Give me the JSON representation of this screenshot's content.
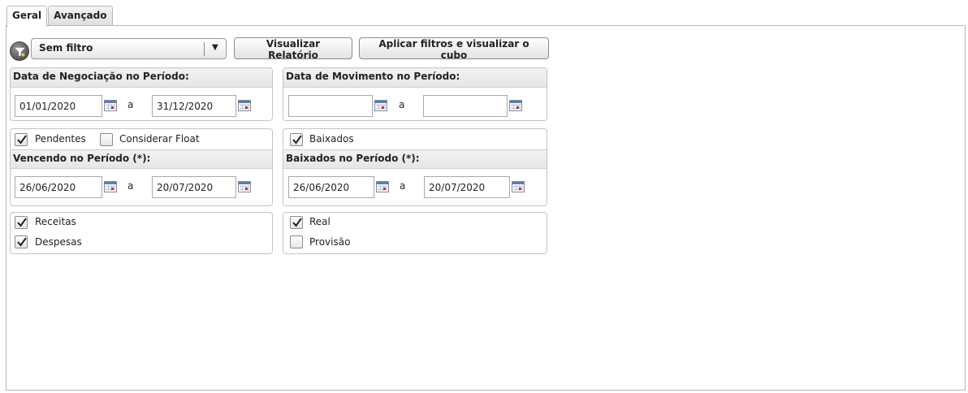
{
  "tabs": [
    {
      "label": "Geral",
      "active": true
    },
    {
      "label": "Avançado",
      "active": false
    }
  ],
  "toolbar": {
    "filter_select": "Sem filtro",
    "view_report_label": "Visualizar Relatório",
    "apply_filters_label": "Aplicar filtros e visualizar o cubo",
    "filter_icon": "filter-icon"
  },
  "negociacao": {
    "title": "Data de Negociação no Período:",
    "from": "01/01/2020",
    "to": "31/12/2020",
    "sep": "a"
  },
  "movimento": {
    "title": "Data de Movimento no Período:",
    "from": "",
    "to": "",
    "sep": "a"
  },
  "pendentes": {
    "pendentes_label": "Pendentes",
    "pendentes_checked": true,
    "float_label": "Considerar Float",
    "float_checked": false,
    "title": "Vencendo no Período (*):",
    "from": "26/06/2020",
    "to": "20/07/2020",
    "sep": "a"
  },
  "baixados": {
    "baixados_label": "Baixados",
    "baixados_checked": true,
    "title": "Baixados no Período (*):",
    "from": "26/06/2020",
    "to": "20/07/2020",
    "sep": "a"
  },
  "tipo": {
    "receitas_label": "Receitas",
    "receitas_checked": true,
    "despesas_label": "Despesas",
    "despesas_checked": true
  },
  "natureza": {
    "real_label": "Real",
    "real_checked": true,
    "provisao_label": "Provisão",
    "provisao_checked": false
  },
  "icons": {
    "calendar": "calendar-icon",
    "checkmark": "check-icon",
    "dropdown": "chevron-down-icon"
  }
}
